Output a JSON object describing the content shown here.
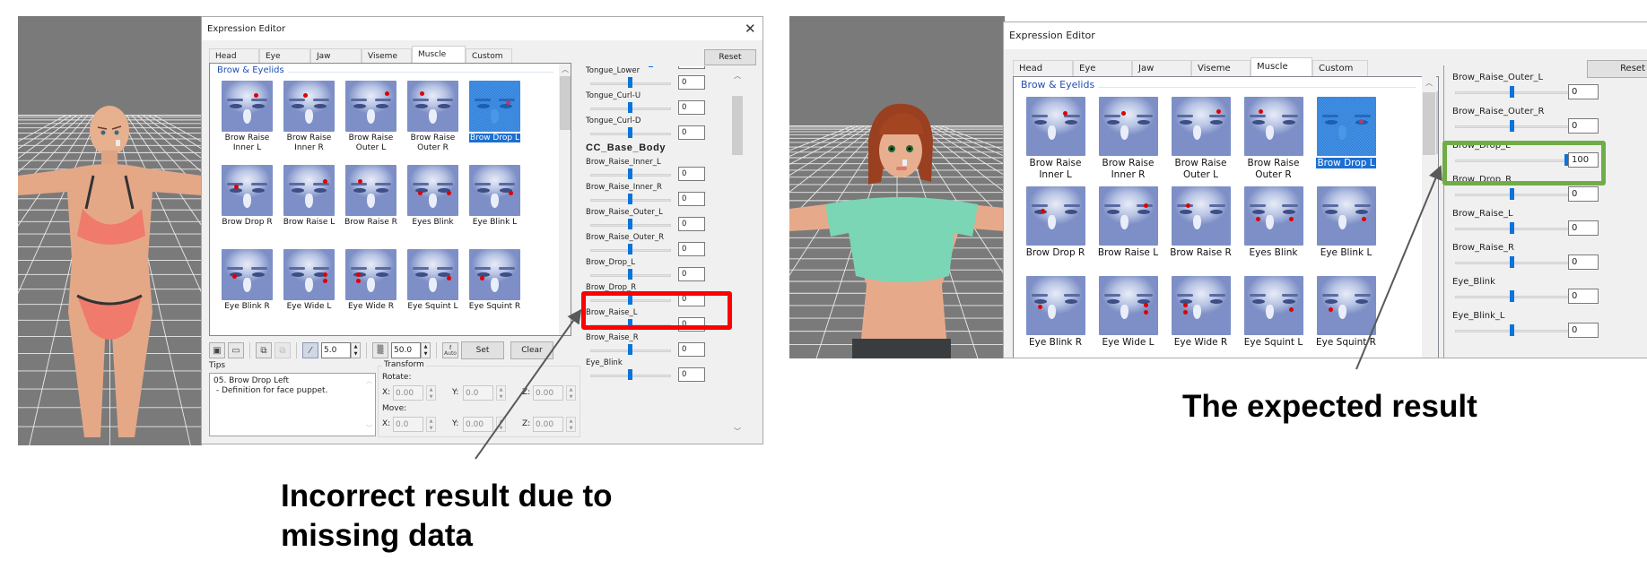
{
  "colors": {
    "incorrect_highlight": "#ff0000",
    "expected_highlight": "#70ad47",
    "accent_blue": "#0a74da",
    "group_title": "#1e4fb4"
  },
  "panels": [
    {
      "id": "incorrect",
      "viewport": {
        "character": "bald-female-avatar-red-bikini"
      },
      "dialog": {
        "title": "Expression Editor",
        "close_icon": "close-icon",
        "tabs": [
          {
            "label": "Head",
            "active": false
          },
          {
            "label": "Eye",
            "active": false
          },
          {
            "label": "Jaw",
            "active": false
          },
          {
            "label": "Viseme",
            "active": false
          },
          {
            "label": "Muscle",
            "active": true
          },
          {
            "label": "Custom",
            "active": false
          }
        ],
        "reset_label": "Reset",
        "group_title": "Brow & Eyelids",
        "faces": [
          {
            "label": "Brow Raise Inner L",
            "l1": "Brow Raise",
            "l2": "Inner L",
            "selected": false
          },
          {
            "label": "Brow Raise Inner R",
            "l1": "Brow Raise",
            "l2": "Inner R",
            "selected": false
          },
          {
            "label": "Brow Raise Outer L",
            "l1": "Brow Raise",
            "l2": "Outer L",
            "selected": false
          },
          {
            "label": "Brow Raise Outer R",
            "l1": "Brow Raise",
            "l2": "Outer R",
            "selected": false
          },
          {
            "label": "Brow Drop L",
            "l1": "Brow Drop L",
            "l2": "",
            "selected": true
          },
          {
            "label": "Brow Drop R",
            "l1": "Brow Drop R",
            "l2": "",
            "selected": false
          },
          {
            "label": "Brow Raise L",
            "l1": "Brow Raise L",
            "l2": "",
            "selected": false
          },
          {
            "label": "Brow Raise R",
            "l1": "Brow Raise R",
            "l2": "",
            "selected": false
          },
          {
            "label": "Eyes Blink",
            "l1": "Eyes Blink",
            "l2": "",
            "selected": false
          },
          {
            "label": "Eye Blink L",
            "l1": "Eye Blink L",
            "l2": "",
            "selected": false
          },
          {
            "label": "Eye Blink R",
            "l1": "Eye Blink R",
            "l2": "",
            "selected": false
          },
          {
            "label": "Eye Wide L",
            "l1": "Eye Wide L",
            "l2": "",
            "selected": false
          },
          {
            "label": "Eye Wide R",
            "l1": "Eye Wide R",
            "l2": "",
            "selected": false
          },
          {
            "label": "Eye Squint L",
            "l1": "Eye Squint L",
            "l2": "",
            "selected": false
          },
          {
            "label": "Eye Squint R",
            "l1": "Eye Squint R",
            "l2": "",
            "selected": false
          }
        ],
        "toolbar": {
          "save_icon": "save-icon",
          "open_icon": "folder-open-icon",
          "copy_icon": "copy-icon",
          "paste_icon": "paste-icon",
          "bone_icon": "bone-icon",
          "brush_size": "5.0",
          "pattern_icon": "checker-icon",
          "strength": "50.0",
          "auto_key_icon": "auto-key-icon",
          "auto_label": "Auto",
          "set_label": "Set",
          "clear_label": "Clear"
        },
        "tips": {
          "label": "Tips",
          "line1": "05. Brow Drop Left",
          "line2": " - Definition for face puppet."
        },
        "transform": {
          "legend": "Transform",
          "rotate_label": "Rotate:",
          "move_label": "Move:",
          "rotate": {
            "x": "0.00",
            "y": "0.0",
            "z": "0.00"
          },
          "move": {
            "x": "0.0",
            "y": "0.00",
            "z": "0.00"
          }
        },
        "sliders": {
          "section_title": "CC_Base_Body",
          "before_section": [
            {
              "label": "Tongue_Lower",
              "value": "0",
              "fraction": 0.5
            },
            {
              "label": "Tongue_Curl-U",
              "value": "0",
              "fraction": 0.5
            },
            {
              "label": "Tongue_Curl-D",
              "value": "0",
              "fraction": 0.5
            }
          ],
          "after_section": [
            {
              "label": "Brow_Raise_Inner_L",
              "value": "0",
              "fraction": 0.5
            },
            {
              "label": "Brow_Raise_Inner_R",
              "value": "0",
              "fraction": 0.5
            },
            {
              "label": "Brow_Raise_Outer_L",
              "value": "0",
              "fraction": 0.5
            },
            {
              "label": "Brow_Raise_Outer_R",
              "value": "0",
              "fraction": 0.5
            },
            {
              "label": "Brow_Drop_L",
              "value": "0",
              "fraction": 0.5,
              "highlight": true
            },
            {
              "label": "Brow_Drop_R",
              "value": "0",
              "fraction": 0.5
            },
            {
              "label": "Brow_Raise_L",
              "value": "0",
              "fraction": 0.5
            },
            {
              "label": "Brow_Raise_R",
              "value": "0",
              "fraction": 0.5
            },
            {
              "label": "Eye_Blink",
              "value": "0",
              "fraction": 0.5
            }
          ]
        }
      },
      "caption": [
        "Incorrect result due to",
        "missing data"
      ]
    },
    {
      "id": "expected",
      "viewport": {
        "character": "red-haired-female-avatar-green-top"
      },
      "dialog": {
        "title": "Expression Editor",
        "tabs": [
          {
            "label": "Head",
            "active": false
          },
          {
            "label": "Eye",
            "active": false
          },
          {
            "label": "Jaw",
            "active": false
          },
          {
            "label": "Viseme",
            "active": false
          },
          {
            "label": "Muscle",
            "active": true
          },
          {
            "label": "Custom",
            "active": false
          }
        ],
        "reset_label": "Reset",
        "group_title": "Brow & Eyelids",
        "faces": [
          {
            "label": "Brow Raise Inner L",
            "l1": "Brow Raise",
            "l2": "Inner L",
            "selected": false
          },
          {
            "label": "Brow Raise Inner R",
            "l1": "Brow Raise",
            "l2": "Inner R",
            "selected": false
          },
          {
            "label": "Brow Raise Outer L",
            "l1": "Brow Raise",
            "l2": "Outer L",
            "selected": false
          },
          {
            "label": "Brow Raise Outer R",
            "l1": "Brow Raise",
            "l2": "Outer R",
            "selected": false
          },
          {
            "label": "Brow Drop L",
            "l1": "Brow Drop L",
            "l2": "",
            "selected": true
          },
          {
            "label": "Brow Drop R",
            "l1": "Brow Drop R",
            "l2": "",
            "selected": false
          },
          {
            "label": "Brow Raise L",
            "l1": "Brow Raise L",
            "l2": "",
            "selected": false
          },
          {
            "label": "Brow Raise R",
            "l1": "Brow Raise R",
            "l2": "",
            "selected": false
          },
          {
            "label": "Eyes Blink",
            "l1": "Eyes Blink",
            "l2": "",
            "selected": false
          },
          {
            "label": "Eye Blink L",
            "l1": "Eye Blink L",
            "l2": "",
            "selected": false
          },
          {
            "label": "Eye Blink R",
            "l1": "Eye Blink R",
            "l2": "",
            "selected": false
          },
          {
            "label": "Eye Wide L",
            "l1": "Eye Wide L",
            "l2": "",
            "selected": false
          },
          {
            "label": "Eye Wide R",
            "l1": "Eye Wide R",
            "l2": "",
            "selected": false
          },
          {
            "label": "Eye Squint L",
            "l1": "Eye Squint L",
            "l2": "",
            "selected": false
          },
          {
            "label": "Eye Squint R",
            "l1": "Eye Squint R",
            "l2": "",
            "selected": false
          }
        ],
        "sliders": {
          "rows": [
            {
              "label": "Brow_Raise_Outer_L",
              "value": "0",
              "fraction": 0.5
            },
            {
              "label": "Brow_Raise_Outer_R",
              "value": "0",
              "fraction": 0.5
            },
            {
              "label": "Brow_Drop_L",
              "value": "100",
              "fraction": 1.0,
              "highlight": true
            },
            {
              "label": "Brow_Drop_R",
              "value": "0",
              "fraction": 0.5
            },
            {
              "label": "Brow_Raise_L",
              "value": "0",
              "fraction": 0.5
            },
            {
              "label": "Brow_Raise_R",
              "value": "0",
              "fraction": 0.5
            },
            {
              "label": "Eye_Blink",
              "value": "0",
              "fraction": 0.5
            },
            {
              "label": "Eye_Blink_L",
              "value": "0",
              "fraction": 0.5
            }
          ]
        }
      },
      "caption": [
        "The expected result"
      ]
    }
  ]
}
